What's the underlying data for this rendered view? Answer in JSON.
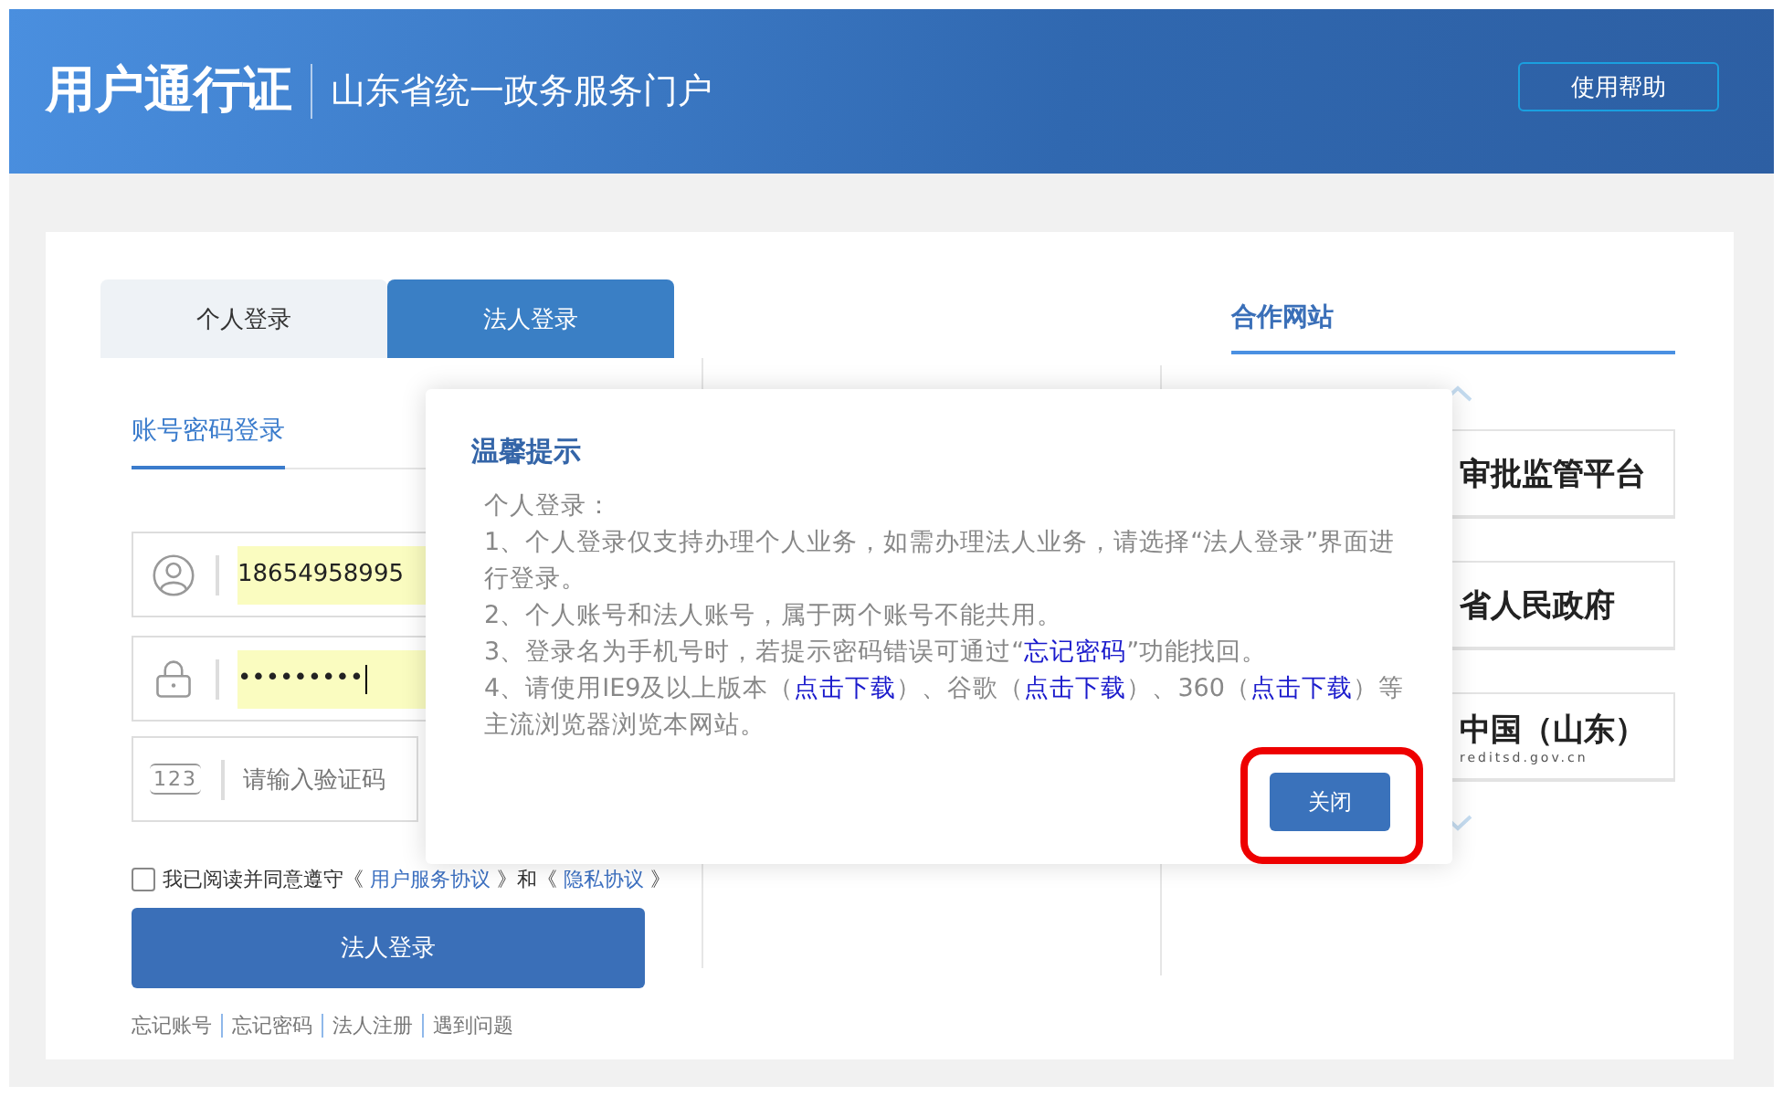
{
  "header": {
    "title": "用户通行证",
    "subtitle": "山东省统一政务服务门户",
    "help_button": "使用帮助"
  },
  "login": {
    "tabs": [
      {
        "label": "个人登录",
        "selected": false
      },
      {
        "label": "法人登录",
        "selected": true
      }
    ],
    "mode_tabs": [
      {
        "label": "账号密码登录",
        "selected": true
      }
    ],
    "fields": [
      {
        "kind": "account",
        "value": "18654958995",
        "autofilled": true,
        "focused": false
      },
      {
        "kind": "password",
        "value": "•••••••••",
        "autofilled": true,
        "focused": true
      },
      {
        "kind": "captcha",
        "icon_text": "123",
        "placeholder": "请输入验证码"
      }
    ],
    "agreement": {
      "checked": false,
      "parts": [
        {
          "kind": "text",
          "text": "我已阅读并同意遵守《 "
        },
        {
          "kind": "link",
          "text": "用户服务协议"
        },
        {
          "kind": "text",
          "text": " 》和《 "
        },
        {
          "kind": "link",
          "text": "隐私协议"
        },
        {
          "kind": "text",
          "text": " 》"
        }
      ]
    },
    "submit_button": "法人登录",
    "links": [
      "忘记账号",
      "忘记密码",
      "法人注册",
      "遇到问题"
    ]
  },
  "partners": {
    "title": "合作网站",
    "sites": [
      {
        "name": "审批监管平台"
      },
      {
        "name": "省人民政府"
      },
      {
        "name": "中国（山东）",
        "url": "reditsd.gov.cn"
      }
    ]
  },
  "dialog": {
    "title": "温馨提示",
    "paragraphs": [
      [
        {
          "kind": "text",
          "text": "个人登录："
        }
      ],
      [
        {
          "kind": "text",
          "text": "1、个人登录仅支持办理个人业务，如需办理法人业务，请选择“法人登录”界面进行登录。"
        }
      ],
      [
        {
          "kind": "text",
          "text": "2、个人账号和法人账号，属于两个账号不能共用。"
        }
      ],
      [
        {
          "kind": "text",
          "text": "3、登录名为手机号时，若提示密码错误可通过“"
        },
        {
          "kind": "link",
          "text": "忘记密码"
        },
        {
          "kind": "text",
          "text": "”功能找回。"
        }
      ],
      [
        {
          "kind": "text",
          "text": "4、请使用IE9及以上版本（"
        },
        {
          "kind": "link",
          "text": "点击下载"
        },
        {
          "kind": "text",
          "text": "）、谷歌（"
        },
        {
          "kind": "link",
          "text": "点击下载"
        },
        {
          "kind": "text",
          "text": "）、360（"
        },
        {
          "kind": "link",
          "text": "点击下载"
        },
        {
          "kind": "text",
          "text": "）等主流浏览器浏览本网站。"
        }
      ]
    ],
    "close_button": "关闭",
    "close_highlighted": true
  }
}
